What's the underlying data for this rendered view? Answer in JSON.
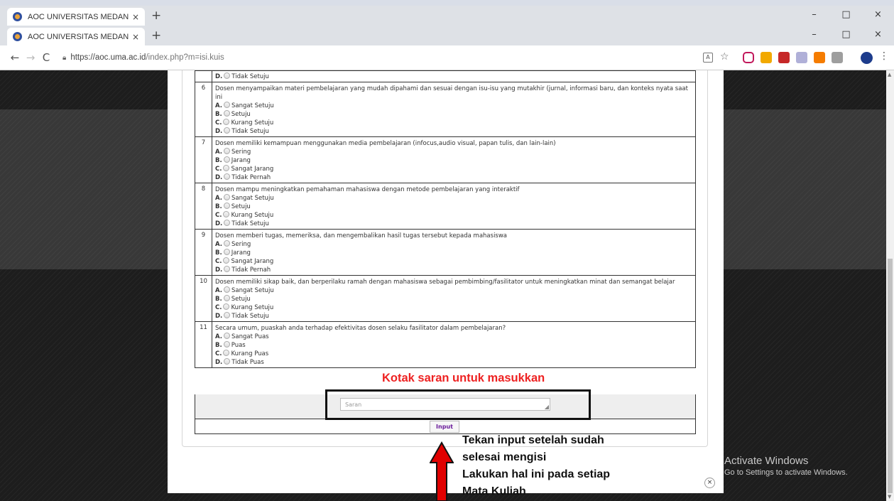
{
  "browser": {
    "tabs": [
      {
        "title": "AOC UNIVERSITAS MEDAN AREA",
        "close": "×"
      },
      {
        "title": "AOC UNIVERSITAS MEDAN AREA",
        "close": "×"
      }
    ],
    "new_tab": "+",
    "window_controls": {
      "minimize": "–",
      "maximize": "□",
      "close": "×"
    },
    "url_host": "https://aoc.uma.ac.id",
    "url_path": "/index.php?m=isi.kuis",
    "nav": {
      "back": "←",
      "forward": "→",
      "reload": "C"
    },
    "menu": "⋮",
    "star": "☆"
  },
  "quiz": {
    "partial_option": {
      "letter": "D.",
      "label": "Tidak Setuju"
    },
    "questions": [
      {
        "number": "6",
        "text": "Dosen menyampaikan materi pembelajaran yang mudah dipahami dan sesuai dengan isu-isu yang mutakhir (jurnal, informasi baru, dan konteks nyata saat ini",
        "options": [
          {
            "letter": "A.",
            "label": "Sangat Setuju"
          },
          {
            "letter": "B.",
            "label": "Setuju"
          },
          {
            "letter": "C.",
            "label": "Kurang Setuju"
          },
          {
            "letter": "D.",
            "label": "Tidak Setuju"
          }
        ]
      },
      {
        "number": "7",
        "text": "Dosen memiliki kemampuan menggunakan media pembelajaran (infocus,audio visual, papan tulis, dan lain-lain)",
        "options": [
          {
            "letter": "A.",
            "label": "Sering"
          },
          {
            "letter": "B.",
            "label": "Jarang"
          },
          {
            "letter": "C.",
            "label": "Sangat Jarang"
          },
          {
            "letter": "D.",
            "label": "Tidak Pernah"
          }
        ]
      },
      {
        "number": "8",
        "text": "Dosen mampu meningkatkan pemahaman mahasiswa dengan metode pembelajaran yang interaktif",
        "options": [
          {
            "letter": "A.",
            "label": "Sangat Setuju"
          },
          {
            "letter": "B.",
            "label": "Setuju"
          },
          {
            "letter": "C.",
            "label": "Kurang Setuju"
          },
          {
            "letter": "D.",
            "label": "Tidak Setuju"
          }
        ]
      },
      {
        "number": "9",
        "text": "Dosen memberi tugas, memeriksa, dan mengembalikan hasil tugas tersebut kepada mahasiswa",
        "options": [
          {
            "letter": "A.",
            "label": "Sering"
          },
          {
            "letter": "B.",
            "label": "Jarang"
          },
          {
            "letter": "C.",
            "label": "Sangat Jarang"
          },
          {
            "letter": "D.",
            "label": "Tidak Pernah"
          }
        ]
      },
      {
        "number": "10",
        "text": "Dosen memiliki sikap baik, dan berperilaku ramah dengan mahasiswa sebagai pembimbing/fasilitator untuk meningkatkan minat dan semangat belajar",
        "options": [
          {
            "letter": "A.",
            "label": "Sangat Setuju"
          },
          {
            "letter": "B.",
            "label": "Setuju"
          },
          {
            "letter": "C.",
            "label": "Kurang Setuju"
          },
          {
            "letter": "D.",
            "label": "Tidak Setuju"
          }
        ]
      },
      {
        "number": "11",
        "text": "Secara umum, puaskah anda terhadap efektivitas dosen selaku fasilitator dalam pembelajaran?",
        "options": [
          {
            "letter": "A.",
            "label": "Sangat Puas"
          },
          {
            "letter": "B.",
            "label": "Puas"
          },
          {
            "letter": "C.",
            "label": "Kurang Puas"
          },
          {
            "letter": "D.",
            "label": "Tidak Puas"
          }
        ]
      }
    ],
    "saran_placeholder": "Saran",
    "submit_label": "Input"
  },
  "annotations": {
    "saran_title": "Kotak saran untuk masukkan",
    "instructions": [
      "Tekan input setelah sudah",
      "selesai mengisi",
      "Lakukan hal ini pada setiap",
      "Mata Kuliah"
    ],
    "title_color": "#e22222",
    "arrow_color": "#e00000"
  },
  "watermark": {
    "line1": "Activate Windows",
    "line2": "Go to Settings to activate Windows."
  },
  "modal_close": "×"
}
